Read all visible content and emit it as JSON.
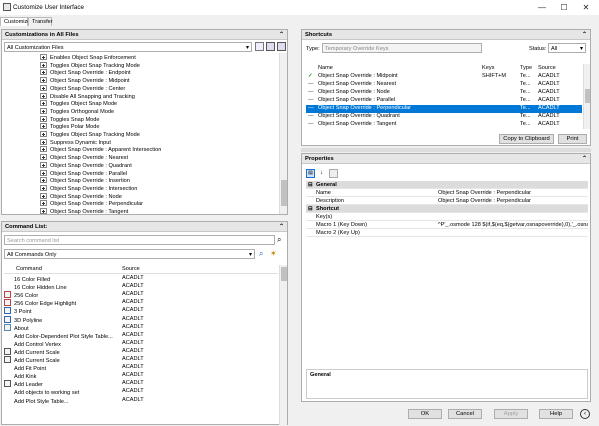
{
  "window": {
    "title": "Customize User Interface",
    "minimize": "—",
    "maximize": "☐",
    "close": "✕"
  },
  "tabs": [
    "Customize",
    "Transfer"
  ],
  "customizations": {
    "header": "Customizations in All Files",
    "filter": "All Customization Files",
    "items": [
      "Enables Object Snap Enforcement",
      "Toggles Object Snap Tracking Mode",
      "Object Snap Override : Endpoint",
      "Object Snap Override : Midpoint",
      "Object Snap Override : Center",
      "Disable All Snapping and Tracking",
      "Toggles Object Snap Mode",
      "Toggles Orthogonal Mode",
      "Toggles Snap Mode",
      "Toggles Polar Mode",
      "Toggles Object Snap Tracking Mode",
      "Suppress Dynamic Input",
      "Object Snap Override : Apparent Intersection",
      "Object Snap Override : Nearest",
      "Object Snap Override : Quadrant",
      "Object Snap Override : Parallel",
      "Object Snap Override : Insertion",
      "Object Snap Override : Intersection",
      "Object Snap Override : Node",
      "Object Snap Override : Perpendicular",
      "Object Snap Override : Tangent"
    ]
  },
  "commands": {
    "header": "Command List:",
    "search_placeholder": "Search command list",
    "filter": "All Commands Only",
    "col_command": "Command",
    "col_source": "Source",
    "rows": [
      {
        "name": "16 Color Filled",
        "source": "ACADLT",
        "icon": "none"
      },
      {
        "name": "16 Color Hidden Line",
        "source": "ACADLT",
        "icon": "none"
      },
      {
        "name": "256 Color",
        "source": "ACADLT",
        "icon": "color"
      },
      {
        "name": "256 Color Edge Highlight",
        "source": "ACADLT",
        "icon": "color"
      },
      {
        "name": "3 Point",
        "source": "ACADLT",
        "icon": "arc"
      },
      {
        "name": "3D Polyline",
        "source": "ACADLT",
        "icon": "poly"
      },
      {
        "name": "About",
        "source": "ACADLT",
        "icon": "info"
      },
      {
        "name": "Add Color-Dependent Plot Style Table...",
        "source": "ACADLT",
        "icon": "none"
      },
      {
        "name": "Add Control Vertex",
        "source": "ACADLT",
        "icon": "none"
      },
      {
        "name": "Add Current Scale",
        "source": "ACADLT",
        "icon": "scale"
      },
      {
        "name": "Add Current Scale",
        "source": "ACADLT",
        "icon": "scale"
      },
      {
        "name": "Add Fit Point",
        "source": "ACADLT",
        "icon": "none"
      },
      {
        "name": "Add Kink",
        "source": "ACADLT",
        "icon": "none"
      },
      {
        "name": "Add Leader",
        "source": "ACADLT",
        "icon": "leader"
      },
      {
        "name": "Add objects to working set",
        "source": "ACADLT",
        "icon": "none"
      },
      {
        "name": "Add Plot Style Table...",
        "source": "ACADLT",
        "icon": "none"
      }
    ]
  },
  "shortcuts": {
    "header": "Shortcuts",
    "type_label": "Type:",
    "type_value": "Temporary Override Keys",
    "status_label": "Status:",
    "status_value": "All",
    "col_name": "Name",
    "col_keys": "Keys",
    "col_type": "Type",
    "col_source": "Source",
    "rows": [
      {
        "name": "Object Snap Override : Midpoint",
        "keys": "SHIFT+M",
        "type": "Te...",
        "source": "ACADLT",
        "icon": "check"
      },
      {
        "name": "Object Snap Override : Nearest",
        "keys": "",
        "type": "Te...",
        "source": "ACADLT",
        "icon": "dash"
      },
      {
        "name": "Object Snap Override : Node",
        "keys": "",
        "type": "Te...",
        "source": "ACADLT",
        "icon": "dash"
      },
      {
        "name": "Object Snap Override : Parallel",
        "keys": "",
        "type": "Te...",
        "source": "ACADLT",
        "icon": "dash"
      },
      {
        "name": "Object Snap Override : Perpendicular",
        "keys": "",
        "type": "Te...",
        "source": "ACADLT",
        "icon": "dash",
        "selected": true
      },
      {
        "name": "Object Snap Override : Quadrant",
        "keys": "",
        "type": "Te...",
        "source": "ACADLT",
        "icon": "dash"
      },
      {
        "name": "Object Snap Override : Tangent",
        "keys": "",
        "type": "Te...",
        "source": "ACADLT",
        "icon": "dash"
      }
    ],
    "copy_button": "Copy to Clipboard",
    "print_button": "Print"
  },
  "properties": {
    "header": "Properties",
    "cat_general": "General",
    "name_label": "Name",
    "name_value": "Object Snap Override : Perpendicular",
    "desc_label": "Description",
    "desc_value": "Object Snap Override : Perpendicular",
    "cat_shortcut": "Shortcut",
    "keys_label": "Key(s)",
    "keys_value": "",
    "macro1_label": "Macro 1 (Key Down)",
    "macro1_value": "^P'_.osmode 128 $(if,$(eq,$(getvar,osnapoverride),0),'_.osnapove",
    "macro2_label": "Macro 2 (Key Up)",
    "macro2_value": "",
    "footer_title": "General"
  },
  "footer": {
    "ok": "OK",
    "cancel": "Cancel",
    "apply": "Apply",
    "help": "Help"
  },
  "colors": {
    "selection": "#0078d7",
    "check": "#2e9e2e",
    "header": "#e6e6e6"
  }
}
